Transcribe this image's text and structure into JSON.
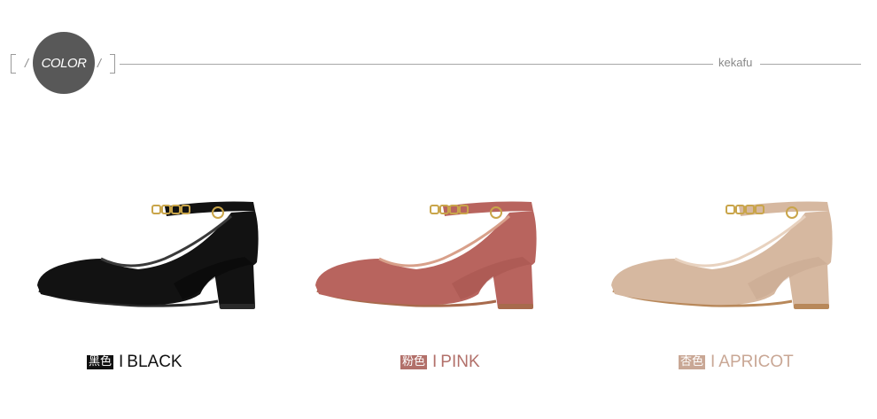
{
  "header": {
    "badge_label": "COLOR",
    "brand": "kekafu"
  },
  "products": [
    {
      "tag": "黑色",
      "separator": "I",
      "name": "BLACK",
      "colors": {
        "upper": "#121212",
        "shade": "#000000",
        "sole": "#2a2a2a",
        "lining": "#3a3a3a"
      },
      "label_color": "#111111",
      "icon": "pump-shoe-icon"
    },
    {
      "tag": "粉色",
      "separator": "I",
      "name": "PINK",
      "colors": {
        "upper": "#b8645e",
        "shade": "#9b4a45",
        "sole": "#a86a4c",
        "lining": "#d8a08a"
      },
      "label_color": "#b2706a",
      "icon": "pump-shoe-icon"
    },
    {
      "tag": "杏色",
      "separator": "I",
      "name": "APRICOT",
      "colors": {
        "upper": "#d6b8a0",
        "shade": "#bf9f86",
        "sole": "#b8885a",
        "lining": "#e8d2bf"
      },
      "label_color": "#c9a795",
      "icon": "pump-shoe-icon"
    }
  ]
}
